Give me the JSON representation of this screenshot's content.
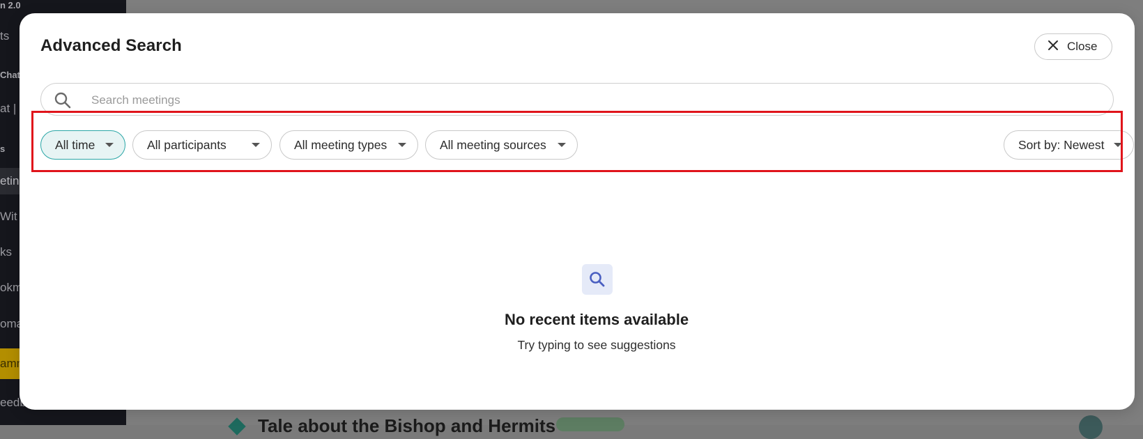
{
  "background": {
    "sidebar_items": [
      {
        "label": "n 2.0",
        "style": "bold"
      },
      {
        "label": "ts",
        "style": "normal"
      },
      {
        "label": "Chat",
        "style": "bold"
      },
      {
        "label": "at |",
        "style": "normal"
      },
      {
        "label": "s",
        "style": "bold"
      },
      {
        "label": "eting",
        "style": "active"
      },
      {
        "label": "Wit",
        "style": "normal"
      },
      {
        "label": "ks",
        "style": "normal"
      },
      {
        "label": "okma",
        "style": "normal"
      },
      {
        "label": "oma",
        "style": "normal"
      },
      {
        "label": "amn",
        "style": "yellow"
      },
      {
        "label": "eedb",
        "style": "normal"
      }
    ],
    "meeting_title": "Tale about the Bishop and Hermits"
  },
  "modal": {
    "title": "Advanced Search",
    "close_label": "Close",
    "search": {
      "placeholder": "Search meetings",
      "value": ""
    },
    "filters": {
      "time": "All time",
      "participants": "All participants",
      "meeting_types": "All meeting types",
      "meeting_sources": "All meeting sources",
      "sort": "Sort by: Newest"
    },
    "empty_state": {
      "title": "No recent items available",
      "subtitle": "Try typing to see suggestions"
    }
  },
  "colors": {
    "active_filter_border": "#2aa6a6",
    "active_filter_bg": "#e7f4f4",
    "highlight": "#e0141b",
    "empty_icon_bg": "#e5eaf8",
    "empty_icon_fg": "#4a5fc1"
  },
  "icons": {
    "close": "close-icon",
    "search": "search-icon",
    "empty": "search-icon",
    "dropdown": "caret-down-icon"
  }
}
